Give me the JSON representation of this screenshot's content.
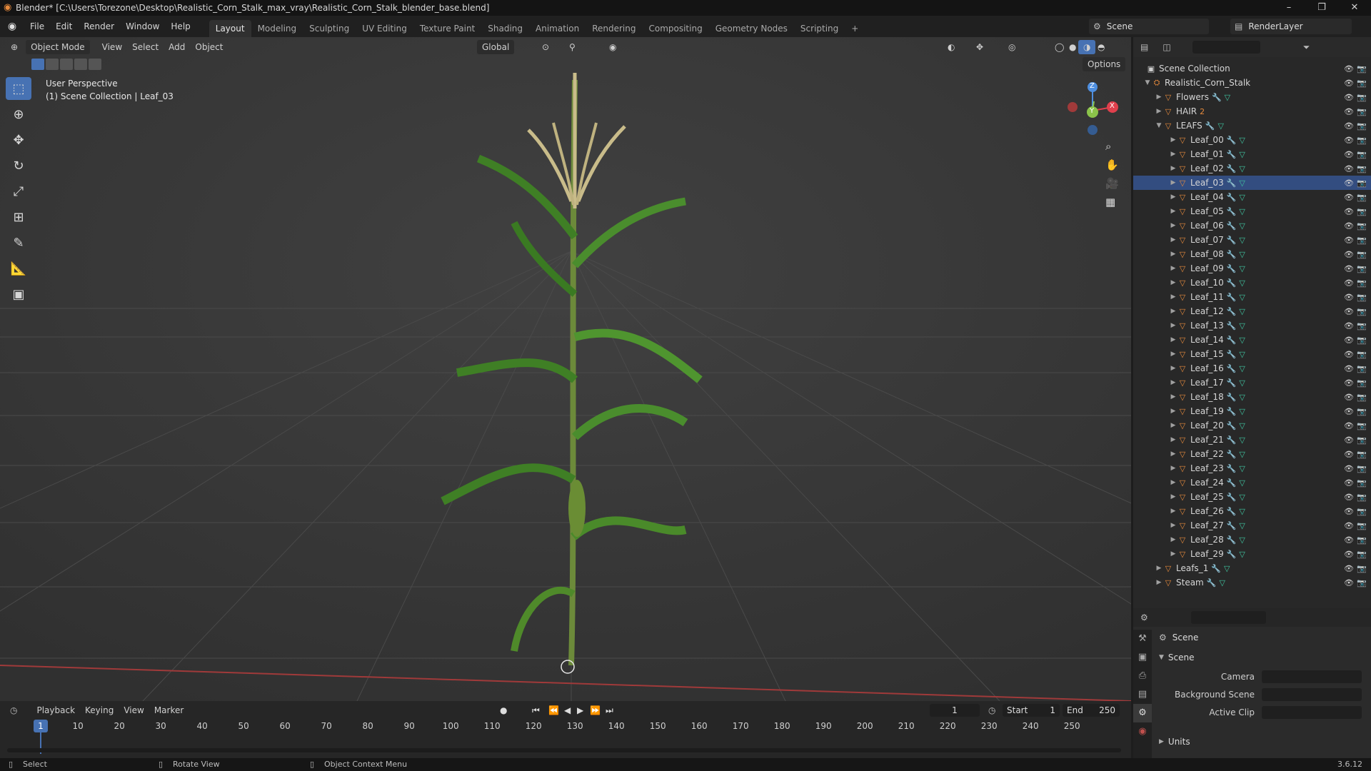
{
  "window": {
    "title": "Blender* [C:\\Users\\Torezone\\Desktop\\Realistic_Corn_Stalk_max_vray\\Realistic_Corn_Stalk_blender_base.blend]",
    "controls": [
      "–",
      "❐",
      "✕"
    ]
  },
  "menubar": {
    "items": [
      "File",
      "Edit",
      "Render",
      "Window",
      "Help"
    ],
    "workspaces": [
      "Layout",
      "Modeling",
      "Sculpting",
      "UV Editing",
      "Texture Paint",
      "Shading",
      "Animation",
      "Rendering",
      "Compositing",
      "Geometry Nodes",
      "Scripting"
    ],
    "active_workspace": "Layout",
    "add_tab": "+",
    "scene_name": "Scene",
    "view_layer": "RenderLayer"
  },
  "viewport": {
    "mode": "Object Mode",
    "menus": [
      "View",
      "Select",
      "Add",
      "Object"
    ],
    "transform_orientation": "Global",
    "options_label": "Options",
    "overlay_line1": "User Perspective",
    "overlay_line2": "(1) Scene Collection | Leaf_03",
    "gizmo_axes": {
      "x": "X",
      "y": "Y",
      "z": "Z"
    },
    "tools": [
      "select-box-icon",
      "cursor-icon",
      "move-icon",
      "rotate-icon",
      "scale-icon",
      "transform-icon",
      "annotate-icon",
      "measure-icon",
      "add-cube-icon"
    ]
  },
  "outliner": {
    "root": "Scene Collection",
    "collection": "Realistic_Corn_Stalk",
    "children": [
      {
        "name": "Flowers",
        "expanded": false
      },
      {
        "name": "HAIR",
        "expanded": false,
        "badge": "2"
      },
      {
        "name": "LEAFS",
        "expanded": true
      }
    ],
    "leaves": [
      "Leaf_00",
      "Leaf_01",
      "Leaf_02",
      "Leaf_03",
      "Leaf_04",
      "Leaf_05",
      "Leaf_06",
      "Leaf_07",
      "Leaf_08",
      "Leaf_09",
      "Leaf_10",
      "Leaf_11",
      "Leaf_12",
      "Leaf_13",
      "Leaf_14",
      "Leaf_15",
      "Leaf_16",
      "Leaf_17",
      "Leaf_18",
      "Leaf_19",
      "Leaf_20",
      "Leaf_21",
      "Leaf_22",
      "Leaf_23",
      "Leaf_24",
      "Leaf_25",
      "Leaf_26",
      "Leaf_27",
      "Leaf_28",
      "Leaf_29"
    ],
    "after": [
      "Leafs_1",
      "Steam"
    ],
    "selected": "Leaf_03"
  },
  "properties": {
    "context": "Scene",
    "panel": "Scene",
    "camera_label": "Camera",
    "background_label": "Background Scene",
    "clip_label": "Active Clip",
    "units_label": "Units"
  },
  "timeline": {
    "menus": [
      "Playback",
      "Keying",
      "View",
      "Marker"
    ],
    "current_frame": "1",
    "start_label": "Start",
    "start": "1",
    "end_label": "End",
    "end": "250",
    "ticks": [
      "10",
      "20",
      "30",
      "40",
      "50",
      "60",
      "70",
      "80",
      "90",
      "100",
      "110",
      "120",
      "130",
      "140",
      "150",
      "160",
      "170",
      "180",
      "190",
      "200",
      "210",
      "220",
      "230",
      "240",
      "250"
    ],
    "playhead": "1"
  },
  "statusbar": {
    "select": "Select",
    "rotate": "Rotate View",
    "context": "Object Context Menu",
    "version": "3.6.12"
  },
  "colors": {
    "accent": "#4772b3",
    "object": "#e68a3c",
    "modifier": "#6a9de0",
    "mesh": "#3fc4a0",
    "x_axis": "#e0404d",
    "y_axis": "#8bc34a",
    "z_axis": "#4e8fe0"
  }
}
